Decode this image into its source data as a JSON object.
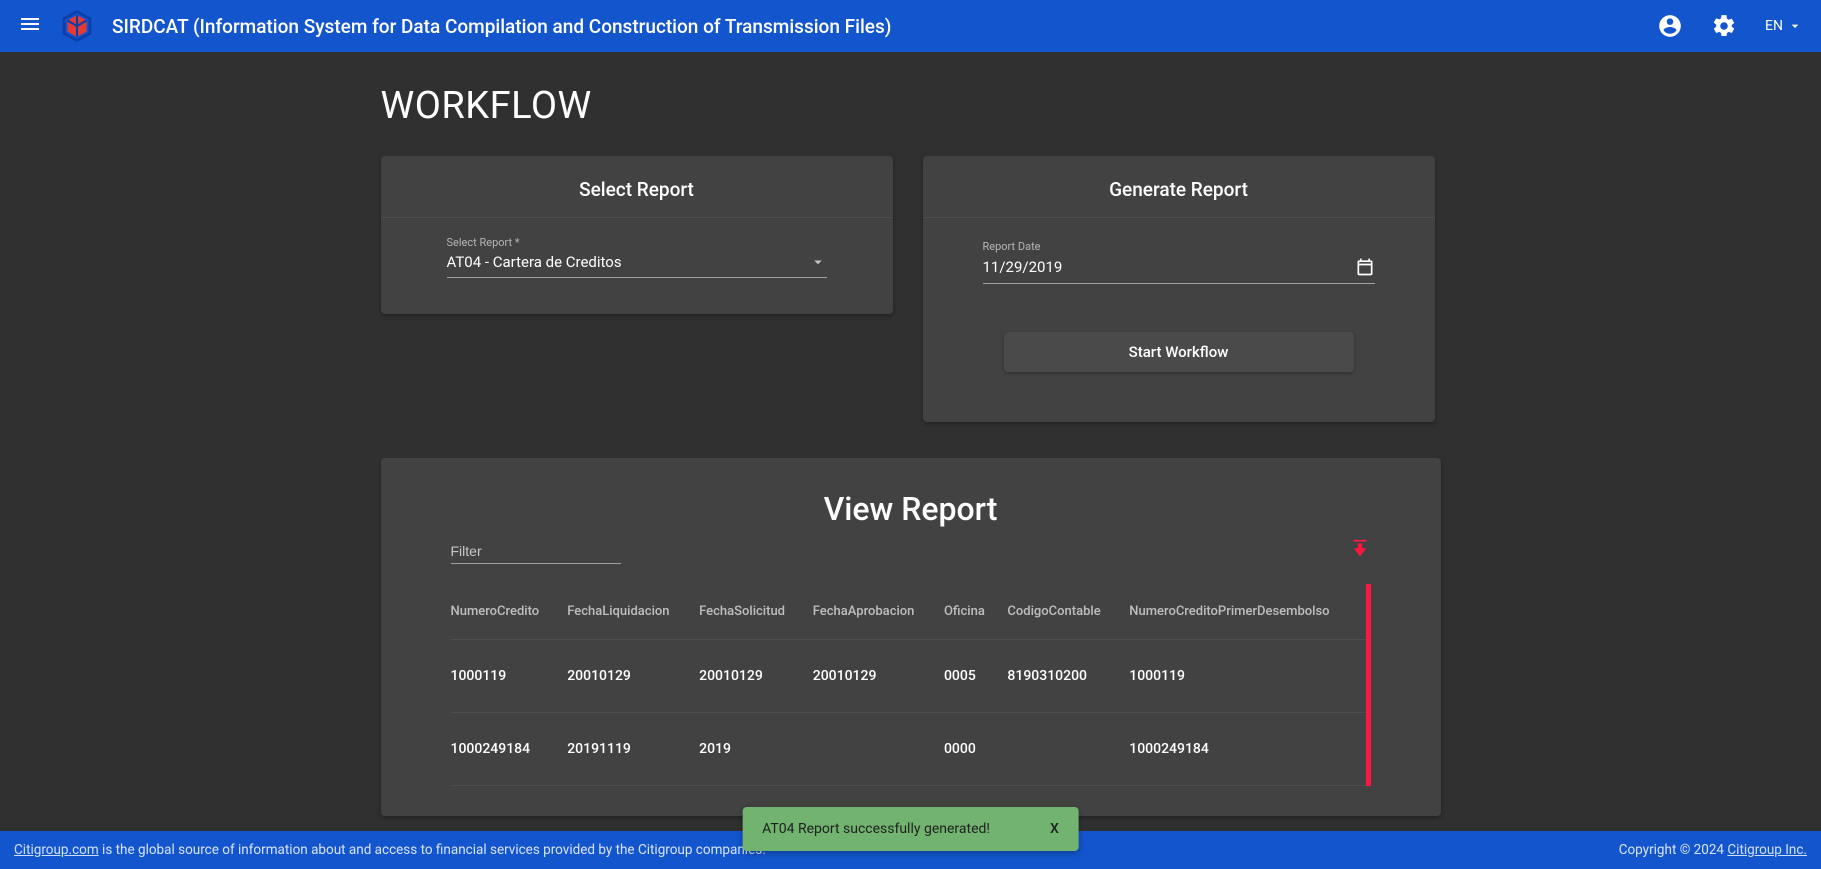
{
  "header": {
    "title": "SIRDCAT (Information System for Data Compilation and Construction of Transmission Files)",
    "language": "EN"
  },
  "page": {
    "title": "WORKFLOW"
  },
  "select_card": {
    "title": "Select Report",
    "label": "Select Report *",
    "value": "AT04 - Cartera de Creditos"
  },
  "generate_card": {
    "title": "Generate Report",
    "date_label": "Report Date",
    "date_value": "11/29/2019",
    "button": "Start Workflow"
  },
  "view_card": {
    "title": "View Report",
    "filter_placeholder": "Filter",
    "columns": [
      "NumeroCredito",
      "FechaLiquidacion",
      "FechaSolicitud",
      "FechaAprobacion",
      "Oficina",
      "CodigoContable",
      "NumeroCreditoPrimerDesembolso"
    ],
    "rows": [
      [
        "1000119",
        "20010129",
        "20010129",
        "20010129",
        "0005",
        "8190310200",
        "1000119"
      ],
      [
        "1000249184",
        "20191119",
        "2019",
        "",
        "0000",
        "",
        "1000249184"
      ]
    ]
  },
  "toast": {
    "message": "AT04 Report successfully generated!",
    "close": "X"
  },
  "footer": {
    "link": "Citigroup.com",
    "text": " is the global source of information about and access to financial services provided by the Citigroup companies.",
    "copyright_prefix": "Copyright © 2024 ",
    "copyright_link": "Citigroup Inc."
  }
}
